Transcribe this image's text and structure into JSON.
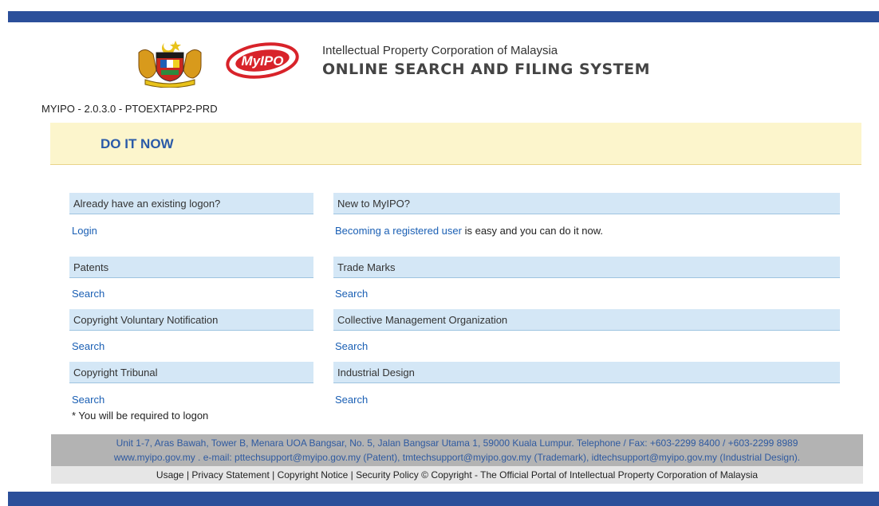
{
  "header": {
    "org_name": "Intellectual Property Corporation of Malaysia",
    "system_name": "ONLINE SEARCH AND FILING SYSTEM",
    "logo_text": "MyIPO"
  },
  "version": "MYIPO - 2.0.3.0 - PTOEXTAPP2-PRD",
  "banner": {
    "title": "DO IT NOW"
  },
  "sections": {
    "existing_logon": {
      "title": "Already have an existing logon?",
      "link": "Login"
    },
    "new_user": {
      "title": "New to MyIPO?",
      "link": "Becoming a registered user",
      "text": " is easy and you can do it now."
    },
    "patents": {
      "title": "Patents",
      "link": "Search"
    },
    "trade_marks": {
      "title": "Trade Marks",
      "link": "Search"
    },
    "copyright_vn": {
      "title": "Copyright Voluntary Notification",
      "link": "Search"
    },
    "cmo": {
      "title": "Collective Management Organization",
      "link": "Search"
    },
    "copyright_tribunal": {
      "title": "Copyright Tribunal",
      "link": "Search"
    },
    "industrial_design": {
      "title": "Industrial Design",
      "link": "Search"
    }
  },
  "note": "* You will be required to logon",
  "footer": {
    "address": "Unit 1-7, Aras Bawah, Tower B, Menara UOA Bangsar, No. 5, Jalan Bangsar Utama 1, 59000 Kuala Lumpur. Telephone / Fax: +603-2299 8400 / +603-2299 8989",
    "emails": "www.myipo.gov.my . e-mail: pttechsupport@myipo.gov.my (Patent), tmtechsupport@myipo.gov.my (Trademark), idtechsupport@myipo.gov.my (Industrial Design).",
    "links": {
      "usage": "Usage",
      "privacy": "Privacy Statement",
      "copyright_notice": "Copyright Notice",
      "security": "Security Policy",
      "copyright": "© Copyright - The Official Portal of Intellectual Property Corporation of Malaysia"
    }
  },
  "colors": {
    "brand_blue": "#2b4f9a",
    "link": "#1a5fb4",
    "banner_bg": "#fcf5cc",
    "section_bg": "#d4e7f6",
    "logo_red": "#d8232a"
  }
}
